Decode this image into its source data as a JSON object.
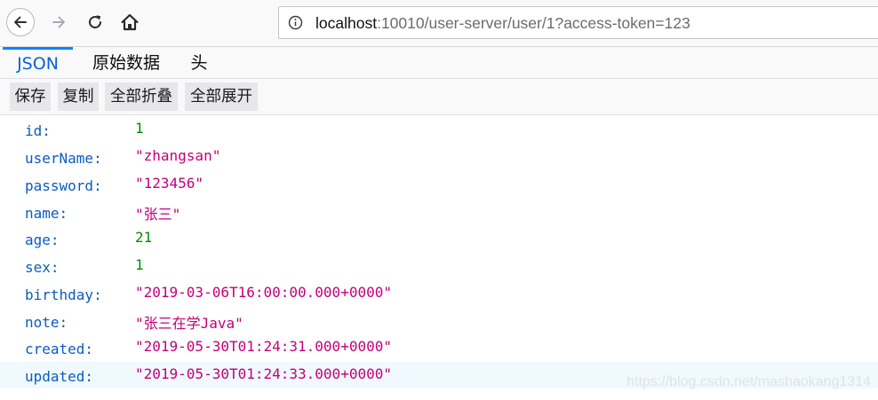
{
  "browser": {
    "url_host": "localhost",
    "url_rest": ":10010/user-server/user/1?access-token=123"
  },
  "tabs": [
    "JSON",
    "原始数据",
    "头"
  ],
  "toolbar": {
    "save": "保存",
    "copy": "复制",
    "collapse_all": "全部折叠",
    "expand_all": "全部展开"
  },
  "rows": [
    {
      "key": "id:",
      "value": "1",
      "type": "number"
    },
    {
      "key": "userName:",
      "value": "\"zhangsan\"",
      "type": "string"
    },
    {
      "key": "password:",
      "value": "\"123456\"",
      "type": "string"
    },
    {
      "key": "name:",
      "value": "\"张三\"",
      "type": "string"
    },
    {
      "key": "age:",
      "value": "21",
      "type": "number"
    },
    {
      "key": "sex:",
      "value": "1",
      "type": "number"
    },
    {
      "key": "birthday:",
      "value": "\"2019-03-06T16:00:00.000+0000\"",
      "type": "string"
    },
    {
      "key": "note:",
      "value": "\"张三在学Java\"",
      "type": "string"
    },
    {
      "key": "created:",
      "value": "\"2019-05-30T01:24:31.000+0000\"",
      "type": "string"
    },
    {
      "key": "updated:",
      "value": "\"2019-05-30T01:24:33.000+0000\"",
      "type": "string"
    }
  ],
  "highlighted_row": 9,
  "watermark": "https://blog.csdn.net/mashaokang1314",
  "colors": {
    "key": "#0b5bc0",
    "number": "#058b00",
    "string": "#c3007a",
    "active_tab": "#0a84ff",
    "row_highlight": "#f0f9fe"
  },
  "icons": {
    "back": "back-arrow-icon",
    "forward": "forward-arrow-icon",
    "reload": "reload-icon",
    "home": "home-icon",
    "site_info": "info-icon"
  }
}
